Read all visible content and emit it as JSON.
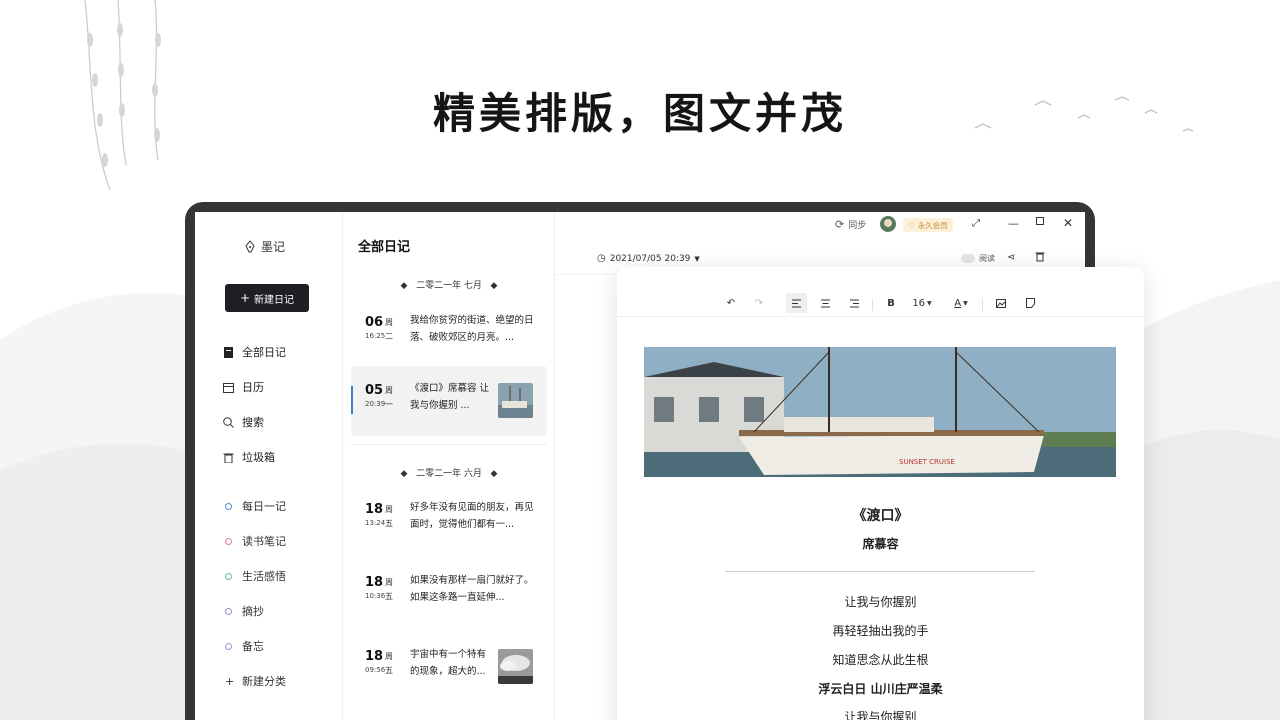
{
  "headline": "精美排版，图文并茂",
  "app": {
    "logo": "墨记",
    "new_button": "新建日记",
    "nav": [
      {
        "label": "全部日记",
        "icon": "notebook-icon"
      },
      {
        "label": "日历",
        "icon": "calendar-icon"
      },
      {
        "label": "搜索",
        "icon": "search-icon"
      },
      {
        "label": "垃圾箱",
        "icon": "trash-icon"
      }
    ],
    "categories": [
      {
        "label": "每日一记",
        "color": "#4a90d9"
      },
      {
        "label": "读书笔记",
        "color": "#e67aa8"
      },
      {
        "label": "生活感悟",
        "color": "#5cc28a"
      },
      {
        "label": "摘抄",
        "color": "#a88bd6"
      },
      {
        "label": "备忘",
        "color": "#b08ad6"
      }
    ],
    "new_category": "新建分类"
  },
  "list": {
    "title": "全部日记",
    "groups": [
      {
        "month": "二零二一年 七月",
        "entries": [
          {
            "day": "06",
            "wk": "周",
            "time": "16:25",
            "wk2": "二",
            "text": "我给你贫穷的街道、绝望的日落、破败郊区的月亮。..."
          },
          {
            "day": "05",
            "wk": "周",
            "time": "20:39",
            "wk2": "一",
            "text": "《渡口》席慕容 让我与你握别 ...",
            "selected": true,
            "thumb": "boat"
          }
        ]
      },
      {
        "month": "二零二一年 六月",
        "entries": [
          {
            "day": "18",
            "wk": "周",
            "time": "13:24",
            "wk2": "五",
            "text": "好多年没有见面的朋友，再见面时，觉得他们都有一..."
          },
          {
            "day": "18",
            "wk": "周",
            "time": "10:36",
            "wk2": "五",
            "text": "如果没有那样一扇门就好了。如果这条路一直延伸..."
          },
          {
            "day": "18",
            "wk": "周",
            "time": "09:56",
            "wk2": "五",
            "text": "宇宙中有一个特有的现象，超大的...",
            "thumb": "clouds"
          }
        ]
      }
    ]
  },
  "editor": {
    "sync": "同步",
    "vip": "永久会员",
    "datetime": "2021/07/05  20:39",
    "read": "阅读",
    "font_size": "16",
    "poem_title": "《渡口》",
    "poem_author": "席慕容",
    "poem_lines": [
      "让我与你握别",
      "再轻轻抽出我的手",
      "知道思念从此生根"
    ],
    "poem_bold_line": "浮云白日 山川庄严温柔",
    "poem_last": "让我与你握别",
    "boat_name": "SUNSET CRUISE"
  }
}
